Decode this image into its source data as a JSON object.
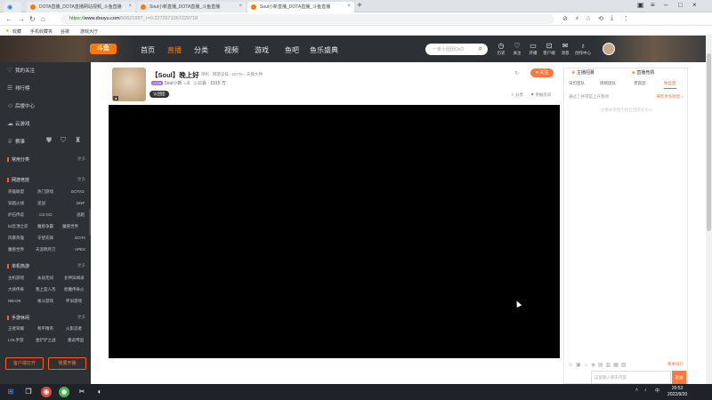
{
  "browser": {
    "tabs": [
      {
        "label": "DOTA直播_DOTA直播网站视频_斗鱼直播",
        "active": false
      },
      {
        "label": "Soul小新直播_DOTA直播_斗鱼直播",
        "active": false
      },
      {
        "label": "Soul小新直播_DOTA直播_斗鱼直播",
        "active": true
      }
    ],
    "url_proto": "https://",
    "url_host": "www.douyu.com",
    "url_rest": "/5062199?_r=0.2272671057229718",
    "bookmarks": [
      "收藏",
      "手机收藏夹",
      "谷歌",
      "游戏大厅"
    ]
  },
  "header": {
    "logo": "斗鱼",
    "nav": [
      "首页",
      "直播",
      "分类",
      "视频",
      "游戏",
      "鱼吧",
      "鱼乐盛典"
    ],
    "active_nav": "直播",
    "search_placeholder": "一条小团团OvO",
    "user_icons": [
      {
        "label": "历史",
        "icon": "clock-icon"
      },
      {
        "label": "关注",
        "icon": "heart-icon"
      },
      {
        "label": "开播",
        "icon": "broadcast-icon"
      },
      {
        "label": "客户端",
        "icon": "monitor-icon"
      },
      {
        "label": "消息",
        "icon": "bell-icon"
      },
      {
        "label": "创作中心",
        "icon": "bulb-icon"
      }
    ]
  },
  "sidebar": {
    "items": [
      {
        "label": "我的关注",
        "icon": "heart-icon"
      },
      {
        "label": "排行榜",
        "icon": "list-icon"
      },
      {
        "label": "后援中心",
        "icon": "user-icon"
      },
      {
        "label": "云游戏",
        "icon": "cloud-icon"
      },
      {
        "label": "赛事",
        "icon": "trophy-icon"
      }
    ],
    "sections": [
      {
        "title": "常用分类",
        "more": "更多"
      },
      {
        "title": "网游竞技",
        "more": "更多"
      },
      {
        "title": "单机热游",
        "more": "更多"
      },
      {
        "title": "手游休闲",
        "more": "更多"
      }
    ],
    "games_netgame": [
      "英雄联盟",
      "热门游戏",
      "DOTA2",
      "穿越火线",
      "逆战",
      "DNF",
      "炉石传说",
      "CS:GO",
      "逃跑",
      "lol云顶之弈",
      "魔兽争霸",
      "魔兽世界",
      "风暴英雄",
      "守望先锋",
      "DOTA",
      "魔兽世界",
      "天涯明月刀",
      "APEX"
    ],
    "games_single": [
      "主机游戏",
      "永劫无间",
      "女神异闻录",
      "大侠传奇",
      "我上是人杰",
      "原魔传奇火",
      "NBA2K",
      "格斗游戏",
      "怀旧游戏"
    ],
    "games_mobile": [
      "王者荣耀",
      "和平精英",
      "火影忍者",
      "LOL手游",
      "金铲铲之战",
      "重返帝国"
    ],
    "buttons": [
      "客户端打开",
      "我要开播"
    ]
  },
  "room": {
    "title": "【Soul】晚上好",
    "breadcrumb": "单机 · 网游竞技 › DOTA › 天梯大神",
    "streamer": "Soul小新",
    "level": "LV25",
    "hot": "6",
    "fans": "公会 · 1915 万",
    "tag": "认团团",
    "follow": "关注",
    "share": "分享",
    "report": "举报房间"
  },
  "right_panel": {
    "tabs": [
      "主播招募",
      "直播竞猜"
    ],
    "subtabs": [
      "日历团队",
      "周榜团队",
      "贵宾团",
      "粉丝团"
    ],
    "active_subtab": "粉丝团",
    "note": "通过了并得是上升我待",
    "link": "来玩更多明星 ›",
    "empty": "主播本场暂无粉丝团成员加入",
    "chat_placeholder": "这里输入聊天内容",
    "send": "发送",
    "rec": "赛事排行"
  },
  "taskbar": {
    "time": "20:53",
    "date": "2022/9/20",
    "lang": "中"
  }
}
